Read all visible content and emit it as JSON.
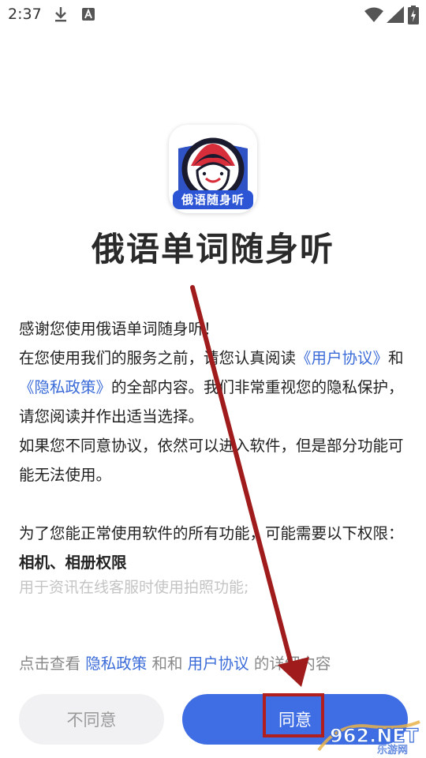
{
  "status_bar": {
    "time": "2:37"
  },
  "app": {
    "icon_label": "俄语随身听",
    "title": "俄语单词随身听"
  },
  "dialog": {
    "greeting": "感谢您使用俄语单词随身听！",
    "intro_prefix": "在您使用我们的服务之前，请您认真阅读",
    "user_agreement_link": "《用户协议》",
    "and_text": "和",
    "privacy_policy_link": "《隐私政策》",
    "intro_suffix": "的全部内容。我们非常重视您的隐私保护，请您阅读并作出适当选择。",
    "disagree_note": "如果您不同意协议，依然可以进入软件，但是部分功能可能无法使用。",
    "permissions_intro": "为了您能正常使用软件的所有功能，可能需要以下权限：",
    "permission_title": "相机、相册权限",
    "permission_desc": "用于资讯在线客服时使用拍照功能;"
  },
  "footer": {
    "prefix": "点击查看",
    "privacy_link": "隐私政策",
    "middle": "和和",
    "user_link": "用户协议",
    "suffix": "的详细内容"
  },
  "buttons": {
    "disagree": "不同意",
    "agree": "同意"
  },
  "watermark": {
    "brand": "962.NET",
    "sub": "乐游网"
  },
  "colors": {
    "accent": "#3f6de4",
    "link": "#3a6bd8",
    "annotation": "#b01e1e"
  }
}
